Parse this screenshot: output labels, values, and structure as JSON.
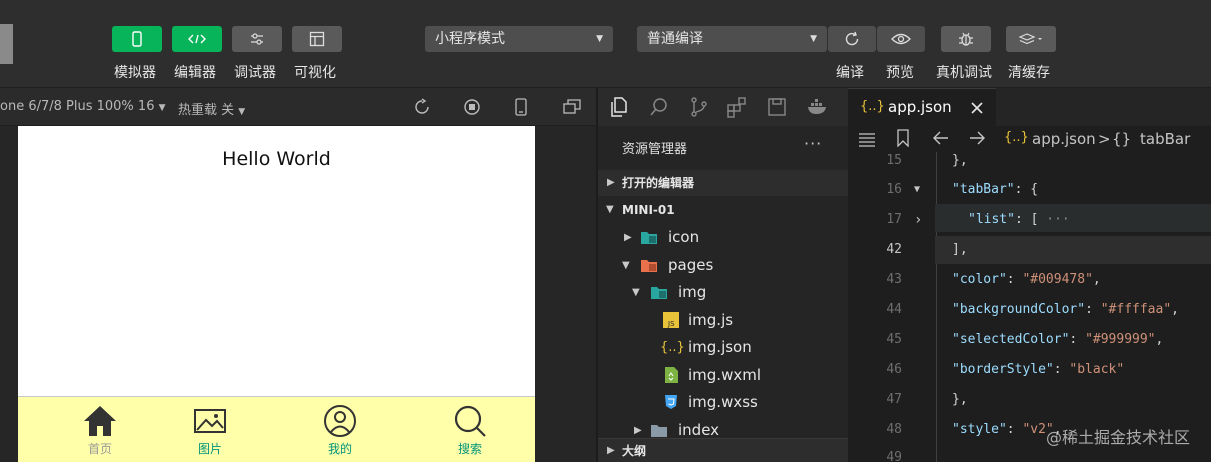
{
  "toolbar": {
    "simulator_label": "模拟器",
    "editor_label": "编辑器",
    "debugger_label": "调试器",
    "visual_label": "可视化",
    "mode_select": "小程序模式",
    "compile_select": "普通编译",
    "compile_label": "编译",
    "preview_label": "预览",
    "remote_debug_label": "真机调试",
    "clear_cache_label": "清缓存"
  },
  "simulator": {
    "device": "one 6/7/8 Plus 100% 16",
    "hot_reload": "热重载 关",
    "hello_text": "Hello World",
    "tabbar": {
      "background": "#ffffaa",
      "selected_color": "#999999",
      "color": "#009478",
      "items": [
        {
          "label": "首页",
          "icon": "home-icon",
          "selected": true
        },
        {
          "label": "图片",
          "icon": "image-icon",
          "selected": false
        },
        {
          "label": "我的",
          "icon": "user-icon",
          "selected": false
        },
        {
          "label": "搜索",
          "icon": "search-icon",
          "selected": false
        }
      ]
    }
  },
  "explorer": {
    "title": "资源管理器",
    "more": "···",
    "open_editors": "打开的编辑器",
    "project": "MINI-01",
    "tree": [
      "icon",
      "pages",
      "img",
      "img.js",
      "img.json",
      "img.wxml",
      "img.wxss",
      "index"
    ],
    "outline": "大纲"
  },
  "editor": {
    "tab_label": "app.json",
    "tab_icon": "{..}",
    "crumb_file": "app.json",
    "crumb_sep": ">",
    "crumb_node": "tabBar",
    "crumb_node_icon": "{}",
    "line_numbers": [
      "15",
      "16",
      "17",
      "42",
      "43",
      "44",
      "45",
      "46",
      "47",
      "48",
      "49"
    ],
    "lines": {
      "l15": "},",
      "l16_key": "\"tabBar\"",
      "l16_rest": ": {",
      "l17_key": "\"list\"",
      "l17_rest": ": [",
      "l17_fold": "···",
      "l42": "],",
      "l43_key": "\"color\"",
      "l43_val": "\"#009478\"",
      "l44_key": "\"backgroundColor\"",
      "l44_val": "\"#ffffaa\"",
      "l45_key": "\"selectedColor\"",
      "l45_val": "\"#999999\"",
      "l46_key": "\"borderStyle\"",
      "l46_val": "\"black\"",
      "l47": "},",
      "l48_key": "\"style\"",
      "l48_val": "\"v2\""
    }
  },
  "watermark": "@稀土掘金技术社区"
}
